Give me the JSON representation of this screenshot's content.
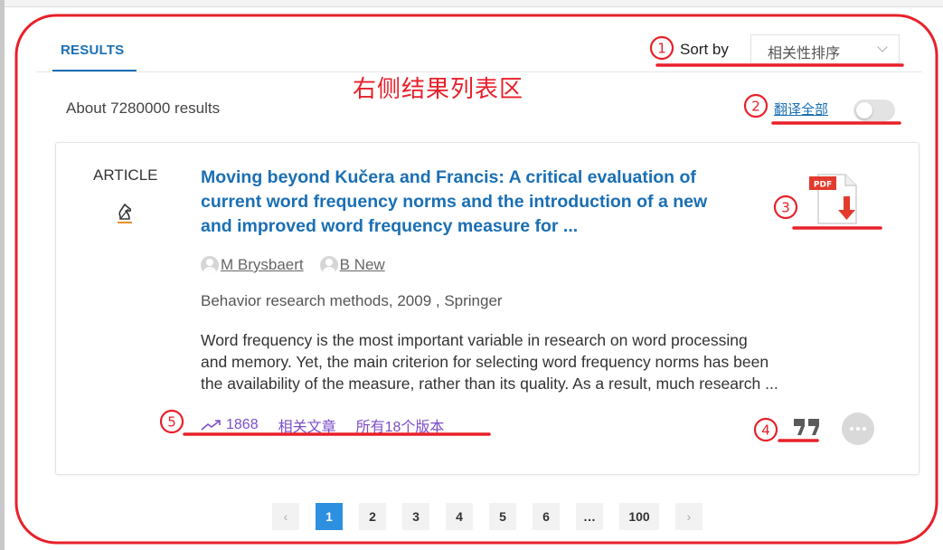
{
  "header": {
    "tab_results": "RESULTS",
    "sort_label": "Sort by",
    "sort_value": "相关性排序"
  },
  "annotation": {
    "area_label": "右侧结果列表区",
    "markers": [
      "1",
      "2",
      "3",
      "4",
      "5"
    ],
    "color": "#e8202a"
  },
  "summary": {
    "results_count": "About 7280000 results",
    "translate_all": "翻译全部",
    "translate_toggle_on": false
  },
  "result": {
    "type_label": "ARTICLE",
    "title_lines": [
      "Moving beyond Kučera and Francis: A critical evaluation of",
      "current word frequency norms and the introduction of a new",
      "and improved word frequency measure for ..."
    ],
    "authors": [
      "M Brysbaert",
      "B New"
    ],
    "source": "Behavior research methods, 2009 , Springer",
    "abstract_lines": [
      "Word frequency is the most important variable in research on word processing",
      "and memory. Yet, the main criterion for selecting word frequency norms has been",
      "the availability of the measure, rather than its quality. As a result, much research ..."
    ],
    "citations": "1868",
    "related_articles": "相关文章",
    "all_versions": "所有18个版本",
    "pdf_badge": "PDF"
  },
  "pagination": {
    "prev": "‹",
    "pages": [
      "1",
      "2",
      "3",
      "4",
      "5",
      "6",
      "…",
      "100"
    ],
    "active": "1",
    "next": "›"
  },
  "colors": {
    "link_blue": "#1a6fb4",
    "stat_purple": "#7d4ec9",
    "active_page": "#2d8fe0"
  }
}
